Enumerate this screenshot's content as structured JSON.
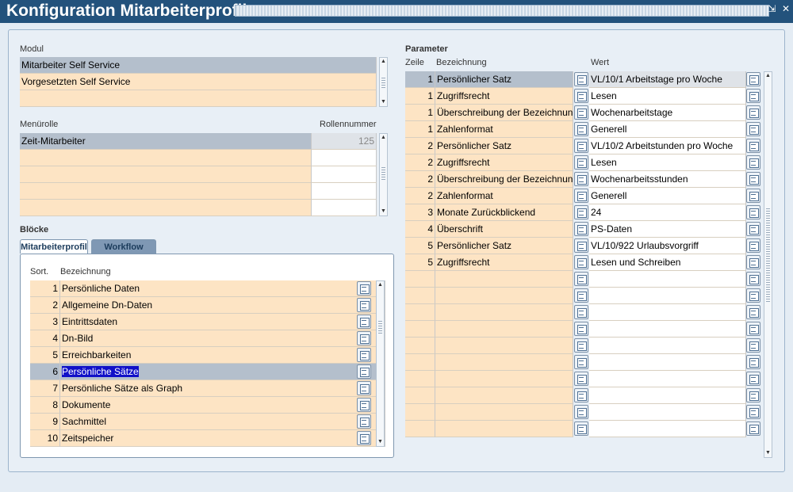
{
  "window": {
    "title": "Konfiguration Mitarbeiterprofil",
    "minimize_label": "⇲",
    "close_label": "✕"
  },
  "modul": {
    "label": "Modul",
    "items": [
      "Mitarbeiter Self Service",
      "Vorgesetzten Self Service",
      ""
    ]
  },
  "menurolle": {
    "label": "Menürolle",
    "col_number": "Rollennummer",
    "rows": [
      {
        "name": "Zeit-Mitarbeiter",
        "number": "125"
      },
      {
        "name": "",
        "number": ""
      },
      {
        "name": "",
        "number": ""
      },
      {
        "name": "",
        "number": ""
      },
      {
        "name": "",
        "number": ""
      }
    ]
  },
  "bloecke": {
    "label": "Blöcke",
    "tabs": [
      "Mitarbeiterprofil",
      "Workflow"
    ],
    "col_sort": "Sort.",
    "col_name": "Bezeichnung",
    "rows": [
      {
        "sort": "1",
        "name": "Persönliche Daten"
      },
      {
        "sort": "2",
        "name": "Allgemeine Dn-Daten"
      },
      {
        "sort": "3",
        "name": "Eintrittsdaten"
      },
      {
        "sort": "4",
        "name": "Dn-Bild"
      },
      {
        "sort": "5",
        "name": "Erreichbarkeiten"
      },
      {
        "sort": "6",
        "name": "Persönliche Sätze"
      },
      {
        "sort": "7",
        "name": "Persönliche Sätze als Graph"
      },
      {
        "sort": "8",
        "name": "Dokumente"
      },
      {
        "sort": "9",
        "name": "Sachmittel"
      },
      {
        "sort": "10",
        "name": "Zeitspeicher"
      }
    ]
  },
  "parameter": {
    "label": "Parameter",
    "col_row": "Zeile",
    "col_name": "Bezeichnung",
    "col_value": "Wert",
    "rows": [
      {
        "zeile": "1",
        "name": "Persönlicher Satz",
        "value": "VL/10/1 Arbeitstage pro Woche"
      },
      {
        "zeile": "1",
        "name": "Zugriffsrecht",
        "value": "Lesen"
      },
      {
        "zeile": "1",
        "name": "Überschreibung der Bezeichnung",
        "value": "Wochenarbeitstage"
      },
      {
        "zeile": "1",
        "name": "Zahlenformat",
        "value": "Generell"
      },
      {
        "zeile": "2",
        "name": "Persönlicher Satz",
        "value": "VL/10/2 Arbeitstunden pro Woche"
      },
      {
        "zeile": "2",
        "name": "Zugriffsrecht",
        "value": "Lesen"
      },
      {
        "zeile": "2",
        "name": "Überschreibung der Bezeichnung",
        "value": "Wochenarbeitsstunden"
      },
      {
        "zeile": "2",
        "name": "Zahlenformat",
        "value": "Generell"
      },
      {
        "zeile": "3",
        "name": "Monate Zurückblickend",
        "value": "24"
      },
      {
        "zeile": "4",
        "name": "Überschrift",
        "value": "PS-Daten"
      },
      {
        "zeile": "5",
        "name": "Persönlicher Satz",
        "value": "VL/10/922 Urlaubsvorgriff"
      },
      {
        "zeile": "5",
        "name": "Zugriffsrecht",
        "value": "Lesen und Schreiben"
      },
      {
        "zeile": "",
        "name": "",
        "value": ""
      },
      {
        "zeile": "",
        "name": "",
        "value": ""
      },
      {
        "zeile": "",
        "name": "",
        "value": ""
      },
      {
        "zeile": "",
        "name": "",
        "value": ""
      },
      {
        "zeile": "",
        "name": "",
        "value": ""
      },
      {
        "zeile": "",
        "name": "",
        "value": ""
      },
      {
        "zeile": "",
        "name": "",
        "value": ""
      },
      {
        "zeile": "",
        "name": "",
        "value": ""
      },
      {
        "zeile": "",
        "name": "",
        "value": ""
      },
      {
        "zeile": "",
        "name": "",
        "value": ""
      }
    ]
  }
}
